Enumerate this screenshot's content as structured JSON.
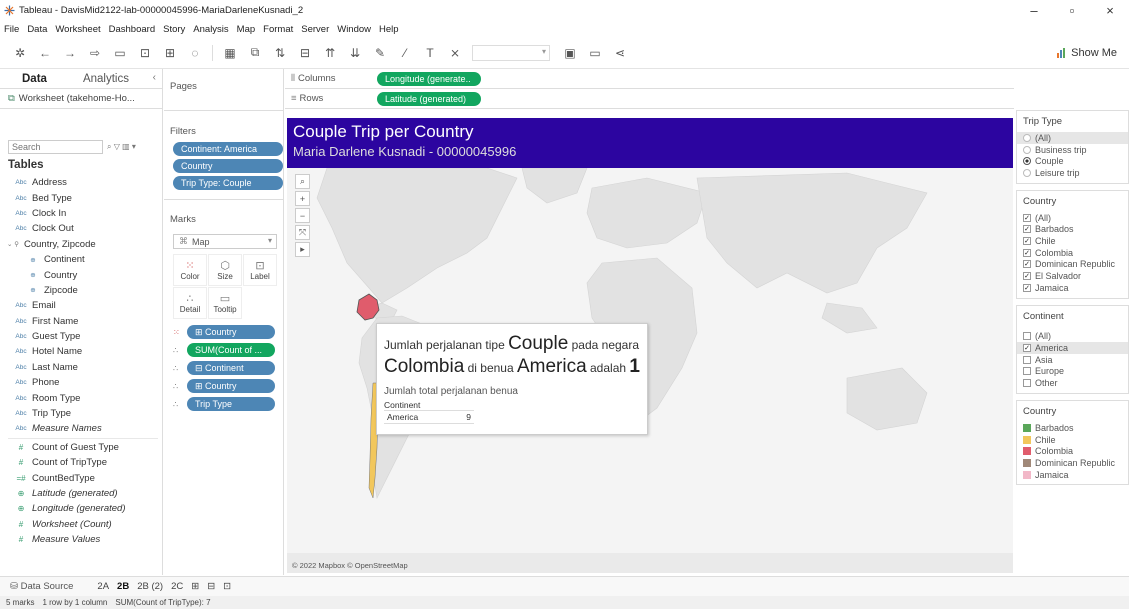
{
  "window": {
    "title": "Tableau - DavisMid2122-lab-00000045996-MariaDarleneKusnadi_2",
    "minimize": "–",
    "maximize": "▫",
    "close": "×"
  },
  "menu": [
    "File",
    "Data",
    "Worksheet",
    "Dashboard",
    "Story",
    "Analysis",
    "Map",
    "Format",
    "Server",
    "Window",
    "Help"
  ],
  "toolbar": {
    "show_me": "Show Me"
  },
  "data_pane": {
    "tab_data": "Data",
    "tab_analytics": "Analytics",
    "collapse": "‹",
    "datasource": "Worksheet (takehome-Ho...",
    "search_placeholder": "Search",
    "tables_heading": "Tables",
    "fields": [
      {
        "type": "Abc",
        "name": "Address"
      },
      {
        "type": "Abc",
        "name": "Bed Type"
      },
      {
        "type": "Abc",
        "name": "Clock In"
      },
      {
        "type": "Abc",
        "name": "Clock Out"
      },
      {
        "type": "⚲",
        "name": "Country, Zipcode"
      },
      {
        "type": "⊕",
        "name": "Continent"
      },
      {
        "type": "⊕",
        "name": "Country"
      },
      {
        "type": "⊕",
        "name": "Zipcode"
      },
      {
        "type": "Abc",
        "name": "Email"
      },
      {
        "type": "Abc",
        "name": "First Name"
      },
      {
        "type": "Abc",
        "name": "Guest Type"
      },
      {
        "type": "Abc",
        "name": "Hotel Name"
      },
      {
        "type": "Abc",
        "name": "Last Name"
      },
      {
        "type": "Abc",
        "name": "Phone"
      },
      {
        "type": "Abc",
        "name": "Room Type"
      },
      {
        "type": "Abc",
        "name": "Trip Type"
      },
      {
        "type": "Abc",
        "name": "Measure Names"
      },
      {
        "type": "#",
        "name": "Count of Guest Type"
      },
      {
        "type": "#",
        "name": "Count of TripType"
      },
      {
        "type": "=#",
        "name": "CountBedType"
      },
      {
        "type": "⊕",
        "name": "Latitude (generated)"
      },
      {
        "type": "⊕",
        "name": "Longitude (generated)"
      },
      {
        "type": "#",
        "name": "Worksheet (Count)"
      },
      {
        "type": "#",
        "name": "Measure Values"
      }
    ]
  },
  "pages": {
    "heading": "Pages"
  },
  "filters": {
    "heading": "Filters",
    "pills": [
      "Continent: America",
      "Country",
      "Trip Type: Couple"
    ]
  },
  "marks": {
    "heading": "Marks",
    "type": "Map",
    "buttons": [
      "Color",
      "Size",
      "Label",
      "Detail",
      "Tooltip"
    ],
    "pills": [
      "⊞ Country",
      "SUM(Count of ...",
      "⊟ Continent",
      "⊞ Country",
      "Trip Type"
    ]
  },
  "shelves": {
    "columns_label": "Columns",
    "columns_pill": "Longitude (generate..",
    "rows_label": "Rows",
    "rows_pill": "Latitude (generated)"
  },
  "sheet": {
    "title": "Couple Trip per Country",
    "subtitle": "Maria Darlene Kusnadi - 00000045996",
    "credit": "© 2022 Mapbox © OpenStreetMap",
    "map_tools": [
      "⌕",
      "+",
      "−",
      "⤧",
      "▸"
    ]
  },
  "tooltip": {
    "p1": "Jumlah perjalanan tipe ",
    "trip_type": "Couple",
    "p2": " pada negara",
    "country": "Colombia",
    "p3": " di benua ",
    "continent": "America",
    "p4": " adalah ",
    "count": "1",
    "total_label": "Jumlah total perjalanan benua",
    "table_header": "Continent",
    "table_continent": "America",
    "table_value": "9"
  },
  "legends": {
    "trip_type": {
      "heading": "Trip Type",
      "options": [
        "(All)",
        "Business trip",
        "Couple",
        "Leisure trip"
      ]
    },
    "country_filter": {
      "heading": "Country",
      "options": [
        "(All)",
        "Barbados",
        "Chile",
        "Colombia",
        "Dominican Republic",
        "El Salvador",
        "Jamaica"
      ]
    },
    "continent": {
      "heading": "Continent",
      "options": [
        "(All)",
        "America",
        "Asia",
        "Europe",
        "Other"
      ]
    },
    "country_color": {
      "heading": "Country",
      "items": [
        {
          "name": "Barbados",
          "color": "#5aa75a"
        },
        {
          "name": "Chile",
          "color": "#f2c75c"
        },
        {
          "name": "Colombia",
          "color": "#e05c6c"
        },
        {
          "name": "Dominican Republic",
          "color": "#a08878"
        },
        {
          "name": "Jamaica",
          "color": "#f2b8c8"
        }
      ]
    }
  },
  "bottom_tabs": {
    "data_source": "Data Source",
    "sheets": [
      "2A",
      "2B",
      "2B (2)",
      "2C"
    ],
    "active": "2B"
  },
  "status": {
    "marks": "5 marks",
    "rows": "1 row by 1 column",
    "sum": "SUM(Count of TripType): 7"
  },
  "colors": {
    "title_bg": "#2c05a0",
    "dimension_pill": "#4d86b5",
    "measure_pill": "#12a65f",
    "colombia": "#e05c6c",
    "chile": "#f2c75c"
  }
}
